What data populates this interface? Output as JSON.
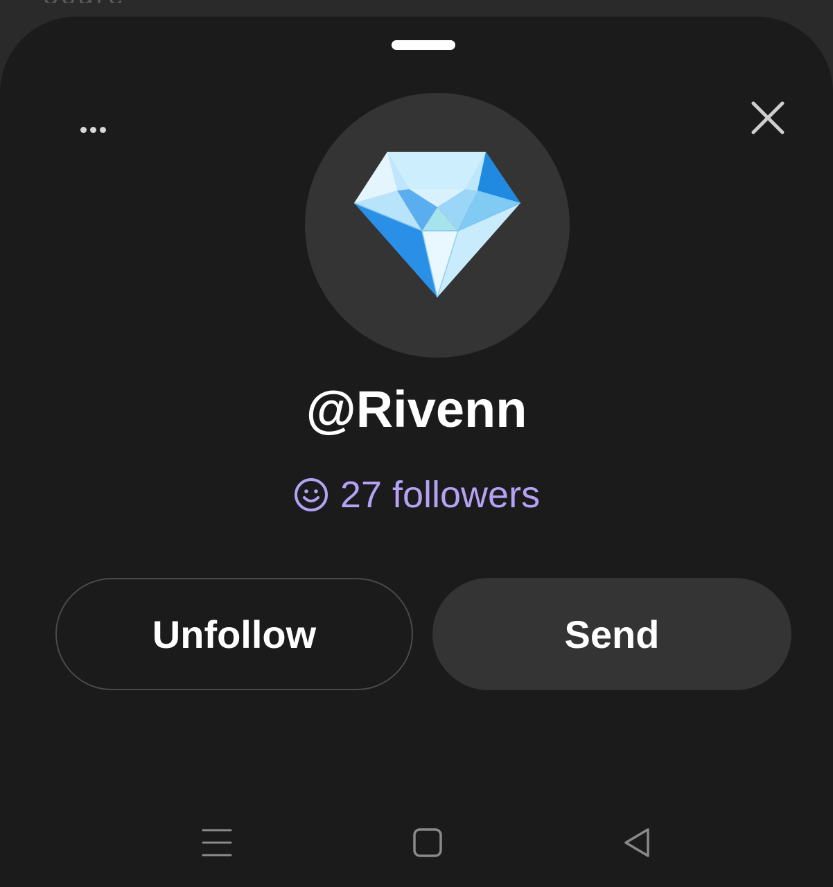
{
  "backdrop": {
    "peek_text": "ocure"
  },
  "sheet": {
    "more_icon": "more-horizontal-icon",
    "close_icon": "close-icon"
  },
  "profile": {
    "avatar_icon": "diamond-icon",
    "username": "@Rivenn",
    "followers_icon": "smiley-icon",
    "followers_text": "27 followers"
  },
  "actions": {
    "unfollow_label": "Unfollow",
    "send_label": "Send"
  },
  "nav": {
    "recents_icon": "recents-icon",
    "home_icon": "home-icon",
    "back_icon": "back-icon"
  },
  "colors": {
    "sheet_bg": "#1b1b1c",
    "surface": "#343435",
    "accent": "#b4a3f5",
    "text": "#ffffff"
  }
}
